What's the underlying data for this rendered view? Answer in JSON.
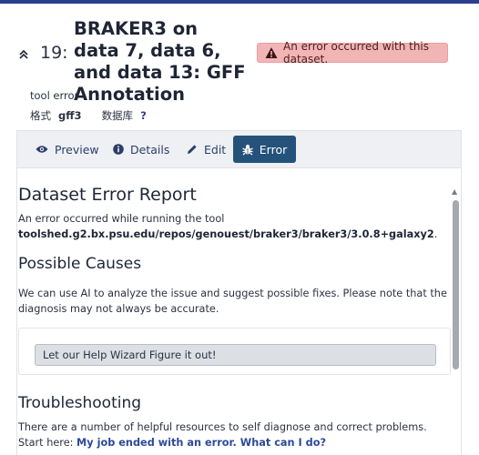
{
  "header": {
    "hid": "19:",
    "title": "BRAKER3 on data 7, data 6, and data 13: GFF Annotation",
    "error_badge": "An error occurred with this dataset.",
    "state_text": "tool error",
    "format_label": "格式",
    "format_value": "gff3",
    "database_label": "数据库",
    "database_value": "?"
  },
  "tabs": [
    {
      "label": "Preview",
      "icon": "eye-icon"
    },
    {
      "label": "Details",
      "icon": "info-icon"
    },
    {
      "label": "Edit",
      "icon": "pencil-icon"
    },
    {
      "label": "Error",
      "icon": "bug-icon",
      "active": true
    }
  ],
  "report": {
    "title": "Dataset Error Report",
    "intro": "An error occurred while running the tool",
    "tool_id": "toolshed.g2.bx.psu.edu/repos/genouest/braker3/braker3/3.0.8+galaxy2",
    "causes_title": "Possible Causes",
    "causes_text": "We can use AI to analyze the issue and suggest possible fixes. Please note that the diagnosis may not always be accurate.",
    "wizard_button": "Let our Help Wizard Figure it out!",
    "troubleshooting_title": "Troubleshooting",
    "troubleshooting_text": "There are a number of helpful resources to self diagnose and correct problems.",
    "start_here": "Start here:",
    "start_link": "My job ended with an error. What can I do?"
  },
  "colors": {
    "accent": "#25527a",
    "badge_bg": "#f2b5b5",
    "link": "#2c4a9a"
  }
}
